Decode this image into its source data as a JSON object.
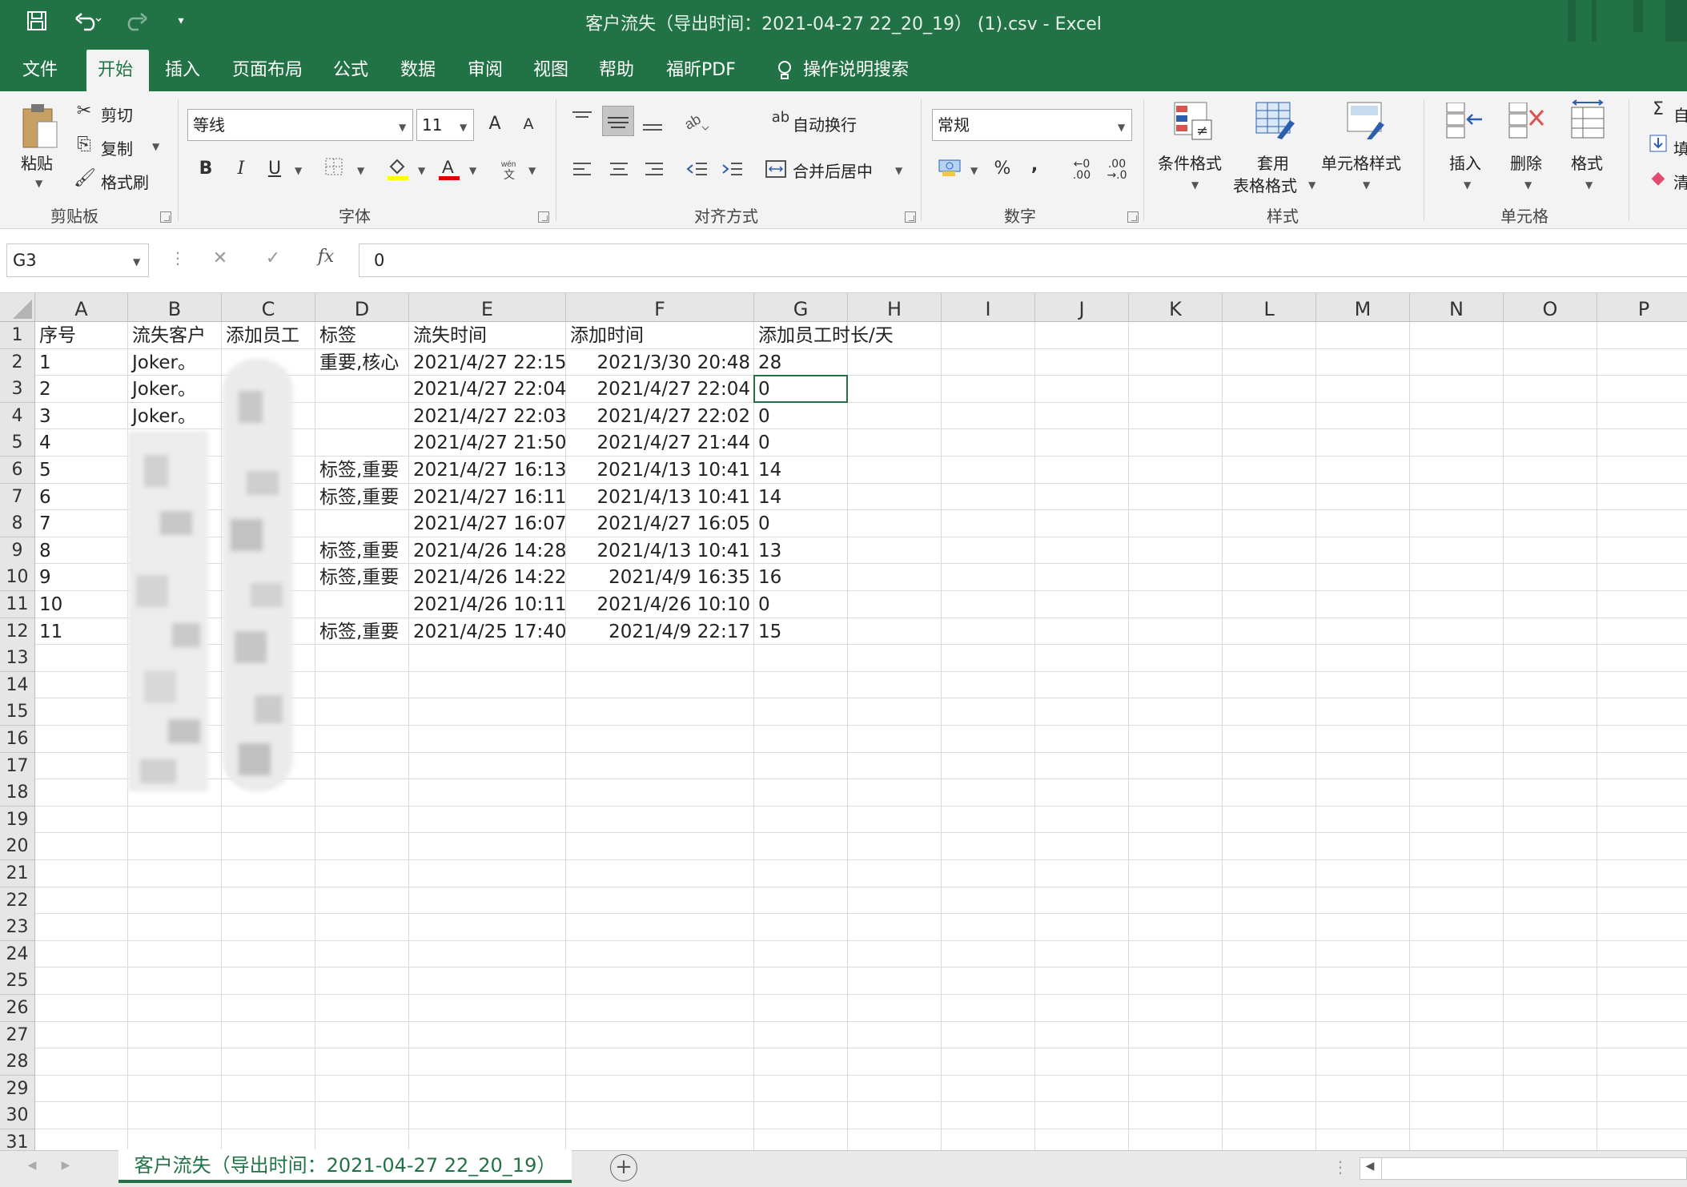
{
  "window": {
    "title": "客户流失（导出时间：2021-04-27 22_20_19） (1).csv  -  Excel"
  },
  "quick_access": {
    "save_icon": "save-icon",
    "undo_icon": "undo-icon",
    "redo_icon": "redo-icon"
  },
  "tabs": [
    "文件",
    "开始",
    "插入",
    "页面布局",
    "公式",
    "数据",
    "审阅",
    "视图",
    "帮助",
    "福昕PDF"
  ],
  "active_tab": "开始",
  "tell_me": "操作说明搜索",
  "ribbon": {
    "clipboard": {
      "paste": "粘贴",
      "cut": "剪切",
      "copy": "复制",
      "format_painter": "格式刷",
      "label": "剪贴板"
    },
    "font": {
      "name": "等线",
      "size": "11",
      "bold": "B",
      "italic": "I",
      "underline": "U",
      "grow": "A",
      "shrink": "A",
      "label": "字体"
    },
    "alignment": {
      "wrap_text": "自动换行",
      "merge_center": "合并后居中",
      "label": "对齐方式"
    },
    "number": {
      "format": "常规",
      "percent": "%",
      "comma": ",",
      "label": "数字"
    },
    "styles": {
      "conditional": "条件格式",
      "table_format_1": "套用",
      "table_format_2": "表格格式",
      "cell_styles": "单元格样式",
      "label": "样式"
    },
    "cells": {
      "insert": "插入",
      "delete": "删除",
      "format": "格式",
      "label": "单元格"
    },
    "editing": {
      "autosum": "自",
      "fill": "填",
      "clear": "清"
    }
  },
  "formula_bar": {
    "name_box": "G3",
    "fx": "fx",
    "value": "0"
  },
  "columns": [
    "A",
    "B",
    "C",
    "D",
    "E",
    "F",
    "G",
    "H",
    "I",
    "J",
    "K",
    "L",
    "M",
    "N",
    "O",
    "P"
  ],
  "row_numbers": [
    "1",
    "2",
    "3",
    "4",
    "5",
    "6",
    "7",
    "8",
    "9",
    "10",
    "11",
    "12",
    "13",
    "14",
    "15",
    "16",
    "17",
    "18",
    "19",
    "20",
    "21",
    "22",
    "23",
    "24",
    "25",
    "26",
    "27",
    "28",
    "29",
    "30",
    "31"
  ],
  "headers": [
    "序号",
    "流失客户",
    "添加员工",
    "标签",
    "流失时间",
    "添加时间",
    "添加员工时长/天"
  ],
  "rows": [
    {
      "id": "1",
      "customer": "Joker。",
      "staff": "",
      "tag": "重要,核心",
      "lost_time": "2021/4/27 22:15",
      "added_time": "2021/3/30 20:48",
      "days": "28"
    },
    {
      "id": "2",
      "customer": "Joker。",
      "staff": "",
      "tag": "",
      "lost_time": "2021/4/27 22:04",
      "added_time": "2021/4/27 22:04",
      "days": "0"
    },
    {
      "id": "3",
      "customer": "Joker。",
      "staff": "",
      "tag": "",
      "lost_time": "2021/4/27 22:03",
      "added_time": "2021/4/27 22:02",
      "days": "0"
    },
    {
      "id": "4",
      "customer": "",
      "staff": "",
      "tag": "",
      "lost_time": "2021/4/27 21:50",
      "added_time": "2021/4/27 21:44",
      "days": "0"
    },
    {
      "id": "5",
      "customer": "",
      "staff": "",
      "tag": "标签,重要",
      "lost_time": "2021/4/27 16:13",
      "added_time": "2021/4/13 10:41",
      "days": "14"
    },
    {
      "id": "6",
      "customer": "",
      "staff": "",
      "tag": "标签,重要",
      "lost_time": "2021/4/27 16:11",
      "added_time": "2021/4/13 10:41",
      "days": "14"
    },
    {
      "id": "7",
      "customer": "",
      "staff": "",
      "tag": "",
      "lost_time": "2021/4/27 16:07",
      "added_time": "2021/4/27 16:05",
      "days": "0"
    },
    {
      "id": "8",
      "customer": "",
      "staff": "",
      "tag": "标签,重要",
      "lost_time": "2021/4/26 14:28",
      "added_time": "2021/4/13 10:41",
      "days": "13"
    },
    {
      "id": "9",
      "customer": "",
      "staff": "",
      "tag": "标签,重要",
      "lost_time": "2021/4/26 14:22",
      "added_time": "2021/4/9 16:35",
      "days": "16"
    },
    {
      "id": "10",
      "customer": "",
      "staff": "",
      "tag": "",
      "lost_time": "2021/4/26 10:11",
      "added_time": "2021/4/26 10:10",
      "days": "0"
    },
    {
      "id": "11",
      "customer": "",
      "staff": "",
      "tag": "标签,重要",
      "lost_time": "2021/4/25 17:40",
      "added_time": "2021/4/9 22:17",
      "days": "15"
    }
  ],
  "sheet_tab": "客户流失（导出时间：2021-04-27 22_20_19）",
  "colors": {
    "excel_green": "#217346",
    "ribbon_bg": "#f3f3f3"
  }
}
